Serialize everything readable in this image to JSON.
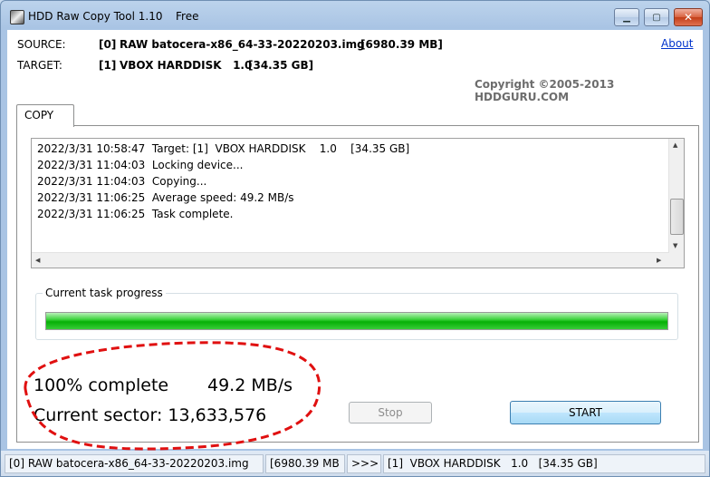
{
  "window": {
    "title": "HDD Raw Copy Tool 1.10",
    "edition": "Free",
    "minimize_glyph": "▁",
    "maximize_glyph": "▢",
    "close_glyph": "✕"
  },
  "header": {
    "source_label": "SOURCE:",
    "source_index": "[0]",
    "source_name": "RAW batocera-x86_64-33-20220203.img",
    "source_size": "[6980.39 MB]",
    "target_label": "TARGET:",
    "target_index": "[1]",
    "target_name": "VBOX HARDDISK   1.0",
    "target_size": "[34.35 GB]",
    "about_link": "About",
    "copyright": "Copyright ©2005-2013 HDDGURU.COM"
  },
  "tabs": [
    {
      "label": "COPY"
    }
  ],
  "log": {
    "lines": [
      {
        "time": "2022/3/31 10:58:47",
        "message": "Target: [1]  VBOX HARDDISK    1.0    [34.35 GB]"
      },
      {
        "time": "2022/3/31 11:04:03",
        "message": "Locking device..."
      },
      {
        "time": "2022/3/31 11:04:03",
        "message": "Copying..."
      },
      {
        "time": "2022/3/31 11:06:25",
        "message": "Average speed: 49.2 MB/s"
      },
      {
        "time": "2022/3/31 11:06:25",
        "message": "Task complete."
      }
    ]
  },
  "progress": {
    "group_title": "Current task progress",
    "fraction": 1.0,
    "percent_text": "100% complete",
    "speed_text": "49.2 MB/s",
    "sector_text": "Current sector: 13,633,576"
  },
  "buttons": {
    "stop": "Stop",
    "start": "START"
  },
  "statusbar": {
    "source": "[0]  RAW batocera-x86_64-33-20220203.img",
    "source_size": "[6980.39 MB",
    "arrow": ">>>",
    "target": "[1]  VBOX HARDDISK   1.0   [34.35 GB]"
  },
  "colors": {
    "progress": "#06b006",
    "annotation": "#e01010",
    "link": "#0033cc"
  }
}
